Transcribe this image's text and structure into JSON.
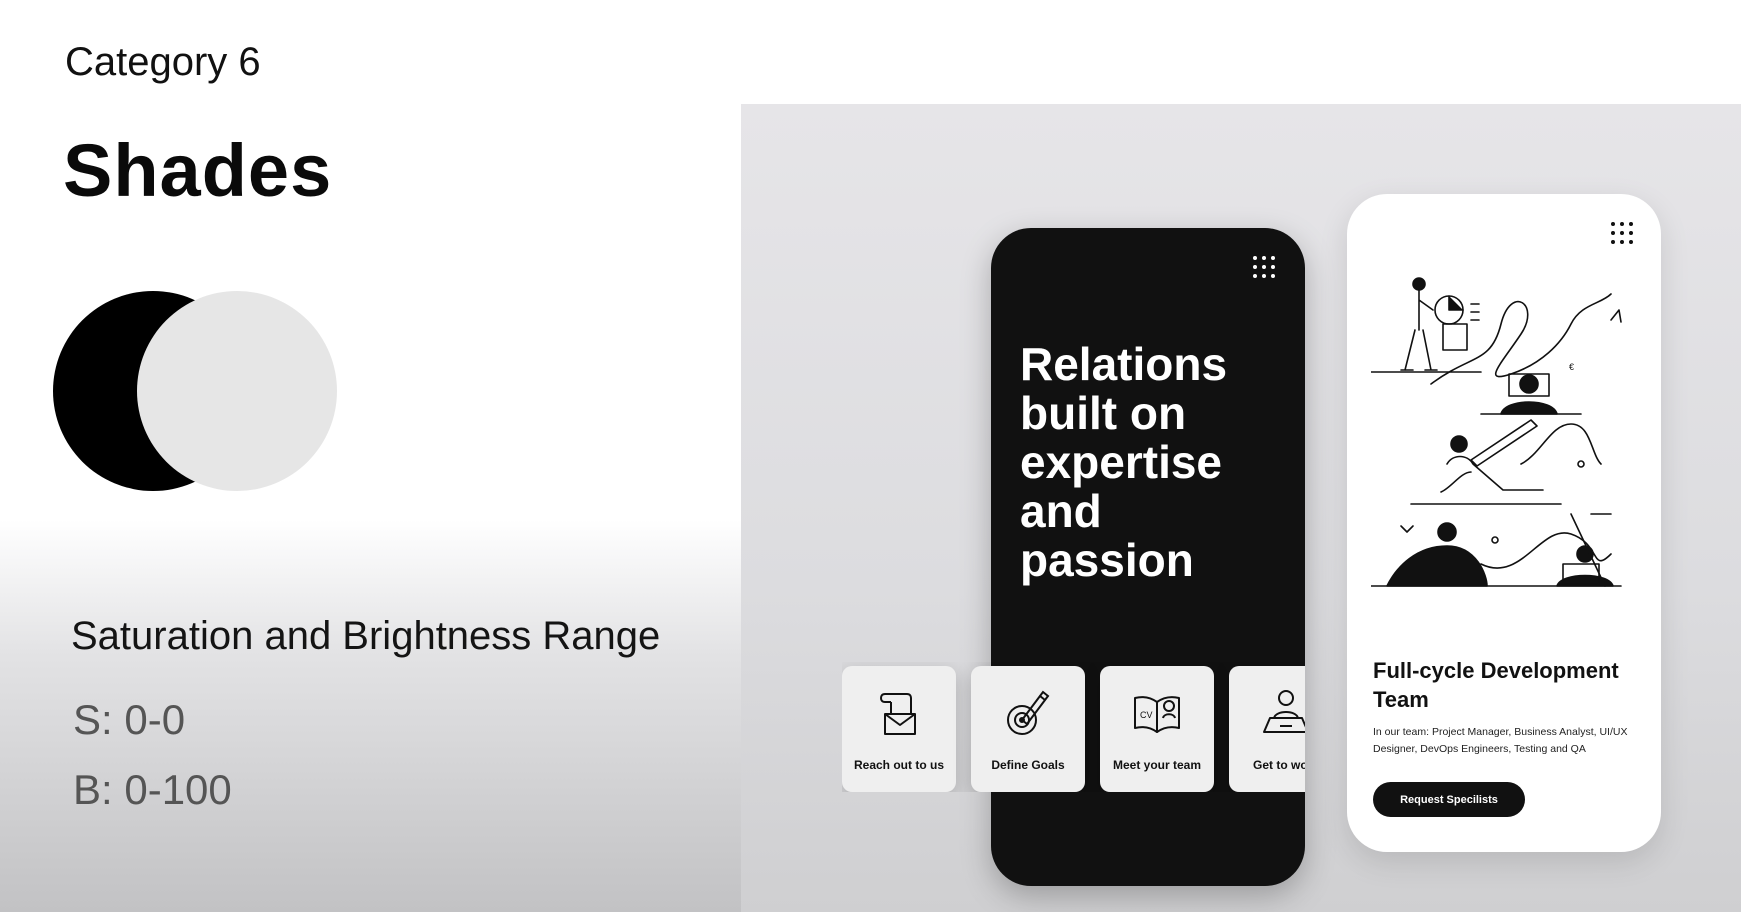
{
  "left": {
    "category": "Category 6",
    "title": "Shades",
    "range_title": "Saturation and Brightness Range",
    "saturation": "S: 0-0",
    "brightness": "B: 0-100"
  },
  "swatches": {
    "dark": "#000000",
    "light": "#e6e6e6"
  },
  "phone_dark": {
    "menu_icon": "grid-dots-icon",
    "headline": "Relations built on expertise and passion",
    "cards": [
      {
        "label": "Reach out to us",
        "icon": "envelope-scroll-icon"
      },
      {
        "label": "Define Goals",
        "icon": "target-pencil-icon"
      },
      {
        "label": "Meet your team",
        "icon": "cv-book-icon"
      },
      {
        "label": "Get to work",
        "icon": "laptop-person-icon"
      }
    ]
  },
  "phone_light": {
    "menu_icon": "grid-dots-icon",
    "team_title": "Full-cycle Development Team",
    "team_desc": "In our team: Project Manager, Business Analyst, UI/UX Designer, DevOps Engineers, Testing and QA",
    "button_label": "Request Specilists"
  }
}
